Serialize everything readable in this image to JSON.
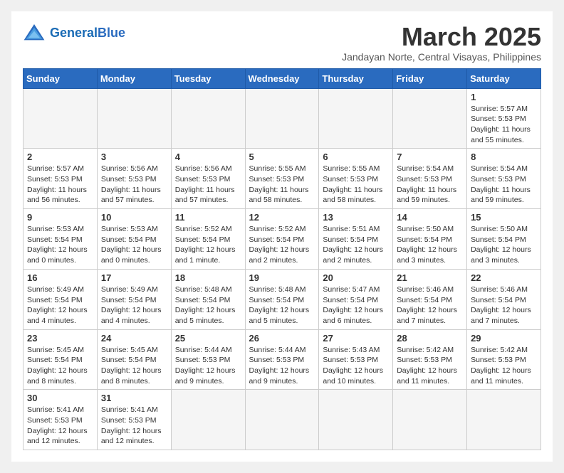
{
  "header": {
    "logo_general": "General",
    "logo_blue": "Blue",
    "month_title": "March 2025",
    "subtitle": "Jandayan Norte, Central Visayas, Philippines"
  },
  "weekdays": [
    "Sunday",
    "Monday",
    "Tuesday",
    "Wednesday",
    "Thursday",
    "Friday",
    "Saturday"
  ],
  "weeks": [
    [
      {
        "day": "",
        "info": ""
      },
      {
        "day": "",
        "info": ""
      },
      {
        "day": "",
        "info": ""
      },
      {
        "day": "",
        "info": ""
      },
      {
        "day": "",
        "info": ""
      },
      {
        "day": "",
        "info": ""
      },
      {
        "day": "1",
        "info": "Sunrise: 5:57 AM\nSunset: 5:53 PM\nDaylight: 11 hours\nand 55 minutes."
      }
    ],
    [
      {
        "day": "2",
        "info": "Sunrise: 5:57 AM\nSunset: 5:53 PM\nDaylight: 11 hours\nand 56 minutes."
      },
      {
        "day": "3",
        "info": "Sunrise: 5:56 AM\nSunset: 5:53 PM\nDaylight: 11 hours\nand 57 minutes."
      },
      {
        "day": "4",
        "info": "Sunrise: 5:56 AM\nSunset: 5:53 PM\nDaylight: 11 hours\nand 57 minutes."
      },
      {
        "day": "5",
        "info": "Sunrise: 5:55 AM\nSunset: 5:53 PM\nDaylight: 11 hours\nand 58 minutes."
      },
      {
        "day": "6",
        "info": "Sunrise: 5:55 AM\nSunset: 5:53 PM\nDaylight: 11 hours\nand 58 minutes."
      },
      {
        "day": "7",
        "info": "Sunrise: 5:54 AM\nSunset: 5:53 PM\nDaylight: 11 hours\nand 59 minutes."
      },
      {
        "day": "8",
        "info": "Sunrise: 5:54 AM\nSunset: 5:53 PM\nDaylight: 11 hours\nand 59 minutes."
      }
    ],
    [
      {
        "day": "9",
        "info": "Sunrise: 5:53 AM\nSunset: 5:54 PM\nDaylight: 12 hours\nand 0 minutes."
      },
      {
        "day": "10",
        "info": "Sunrise: 5:53 AM\nSunset: 5:54 PM\nDaylight: 12 hours\nand 0 minutes."
      },
      {
        "day": "11",
        "info": "Sunrise: 5:52 AM\nSunset: 5:54 PM\nDaylight: 12 hours\nand 1 minute."
      },
      {
        "day": "12",
        "info": "Sunrise: 5:52 AM\nSunset: 5:54 PM\nDaylight: 12 hours\nand 2 minutes."
      },
      {
        "day": "13",
        "info": "Sunrise: 5:51 AM\nSunset: 5:54 PM\nDaylight: 12 hours\nand 2 minutes."
      },
      {
        "day": "14",
        "info": "Sunrise: 5:50 AM\nSunset: 5:54 PM\nDaylight: 12 hours\nand 3 minutes."
      },
      {
        "day": "15",
        "info": "Sunrise: 5:50 AM\nSunset: 5:54 PM\nDaylight: 12 hours\nand 3 minutes."
      }
    ],
    [
      {
        "day": "16",
        "info": "Sunrise: 5:49 AM\nSunset: 5:54 PM\nDaylight: 12 hours\nand 4 minutes."
      },
      {
        "day": "17",
        "info": "Sunrise: 5:49 AM\nSunset: 5:54 PM\nDaylight: 12 hours\nand 4 minutes."
      },
      {
        "day": "18",
        "info": "Sunrise: 5:48 AM\nSunset: 5:54 PM\nDaylight: 12 hours\nand 5 minutes."
      },
      {
        "day": "19",
        "info": "Sunrise: 5:48 AM\nSunset: 5:54 PM\nDaylight: 12 hours\nand 5 minutes."
      },
      {
        "day": "20",
        "info": "Sunrise: 5:47 AM\nSunset: 5:54 PM\nDaylight: 12 hours\nand 6 minutes."
      },
      {
        "day": "21",
        "info": "Sunrise: 5:46 AM\nSunset: 5:54 PM\nDaylight: 12 hours\nand 7 minutes."
      },
      {
        "day": "22",
        "info": "Sunrise: 5:46 AM\nSunset: 5:54 PM\nDaylight: 12 hours\nand 7 minutes."
      }
    ],
    [
      {
        "day": "23",
        "info": "Sunrise: 5:45 AM\nSunset: 5:54 PM\nDaylight: 12 hours\nand 8 minutes."
      },
      {
        "day": "24",
        "info": "Sunrise: 5:45 AM\nSunset: 5:54 PM\nDaylight: 12 hours\nand 8 minutes."
      },
      {
        "day": "25",
        "info": "Sunrise: 5:44 AM\nSunset: 5:53 PM\nDaylight: 12 hours\nand 9 minutes."
      },
      {
        "day": "26",
        "info": "Sunrise: 5:44 AM\nSunset: 5:53 PM\nDaylight: 12 hours\nand 9 minutes."
      },
      {
        "day": "27",
        "info": "Sunrise: 5:43 AM\nSunset: 5:53 PM\nDaylight: 12 hours\nand 10 minutes."
      },
      {
        "day": "28",
        "info": "Sunrise: 5:42 AM\nSunset: 5:53 PM\nDaylight: 12 hours\nand 11 minutes."
      },
      {
        "day": "29",
        "info": "Sunrise: 5:42 AM\nSunset: 5:53 PM\nDaylight: 12 hours\nand 11 minutes."
      }
    ],
    [
      {
        "day": "30",
        "info": "Sunrise: 5:41 AM\nSunset: 5:53 PM\nDaylight: 12 hours\nand 12 minutes."
      },
      {
        "day": "31",
        "info": "Sunrise: 5:41 AM\nSunset: 5:53 PM\nDaylight: 12 hours\nand 12 minutes."
      },
      {
        "day": "",
        "info": ""
      },
      {
        "day": "",
        "info": ""
      },
      {
        "day": "",
        "info": ""
      },
      {
        "day": "",
        "info": ""
      },
      {
        "day": "",
        "info": ""
      }
    ]
  ]
}
